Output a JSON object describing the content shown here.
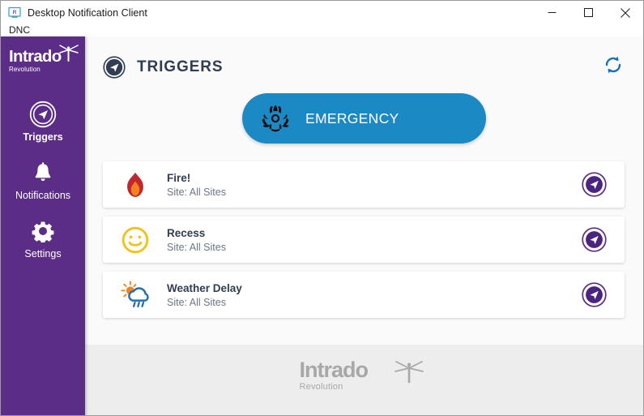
{
  "window": {
    "title": "Desktop Notification Client",
    "app_icon": "monitor-r-icon",
    "controls": {
      "minimize": "minimize-icon",
      "maximize": "maximize-icon",
      "close": "close-icon"
    }
  },
  "menubar": {
    "items": [
      {
        "label": "DNC"
      }
    ]
  },
  "sidebar": {
    "brand": {
      "name": "Intrado",
      "tagline": "Revolution",
      "mark": "dragonfly-icon"
    },
    "items": [
      {
        "label": "Triggers",
        "icon": "send-circle-icon",
        "active": true
      },
      {
        "label": "Notifications",
        "icon": "bell-icon",
        "active": false
      },
      {
        "label": "Settings",
        "icon": "gear-icon",
        "active": false
      }
    ]
  },
  "main": {
    "header": {
      "title": "TRIGGERS",
      "icon": "send-circle-icon",
      "refresh": "refresh-icon"
    },
    "emergency": {
      "label": "EMERGENCY",
      "icon": "biohazard-icon",
      "color": "#1b8ac4"
    },
    "triggers": [
      {
        "title": "Fire!",
        "subtitle": "Site: All Sites",
        "icon": "flame-icon",
        "send": "send-circle-icon"
      },
      {
        "title": "Recess",
        "subtitle": "Site: All Sites",
        "icon": "smiley-icon",
        "send": "send-circle-icon"
      },
      {
        "title": "Weather Delay",
        "subtitle": "Site: All Sites",
        "icon": "sun-rain-cloud-icon",
        "send": "send-circle-icon"
      }
    ]
  },
  "footer": {
    "brand": {
      "name": "Intrado",
      "tagline": "Revolution",
      "mark": "dragonfly-icon"
    }
  },
  "colors": {
    "sidebar": "#5c2d87",
    "accent_blue": "#1b8ac4",
    "send_purple": "#5c2d87",
    "title_navy": "#2f3e52",
    "footer_bg": "#ededed"
  }
}
